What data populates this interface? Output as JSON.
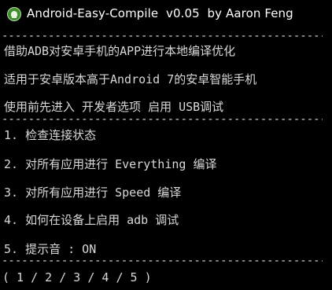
{
  "window": {
    "title": "Android-Easy-Compile  v0.05  by Aaron Feng"
  },
  "header_lines": [
    "借助ADB对安卓手机的APP进行本地编译优化",
    "适用于安卓版本高于Android 7的安卓智能手机",
    "使用前先进入 开发者选项 启用 USB调试"
  ],
  "menu": {
    "items": [
      {
        "label": "1. 检查连接状态"
      },
      {
        "label": "2. 对所有应用进行 Everything 编译"
      },
      {
        "label": "3. 对所有应用进行 Speed 编译"
      },
      {
        "label": "4. 如何在设备上启用 adb 调试"
      },
      {
        "label": "5. 提示音 : ON"
      }
    ]
  },
  "prompt": {
    "text": "( 1 / 2 / 3 / 4 / 5 )"
  },
  "colors": {
    "background": "#000000",
    "text": "#d8d8d8",
    "title_text": "#ffffff",
    "icon_green": "#3f8f2c"
  }
}
